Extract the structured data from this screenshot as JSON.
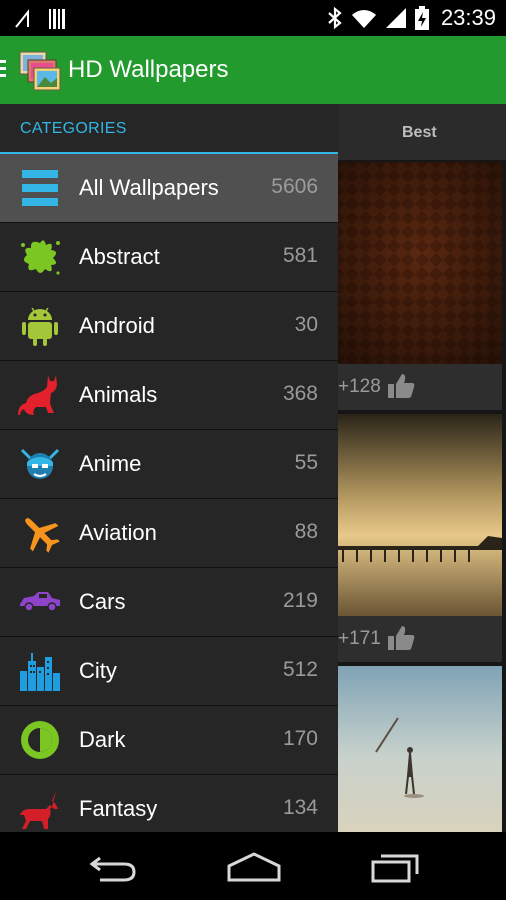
{
  "status_bar": {
    "time": "23:39",
    "icons": [
      "missed-call-icon",
      "barcode-icon",
      "bluetooth-icon",
      "wifi-icon",
      "signal-icon",
      "battery-charging-icon"
    ]
  },
  "action_bar": {
    "title": "HD Wallpapers",
    "icons": [
      "drawer-indicator-icon",
      "app-logo-icon"
    ],
    "color": "#229a2e"
  },
  "background": {
    "tab_label": "Best",
    "cards": [
      {
        "likes": "+128"
      },
      {
        "likes": "+171"
      },
      {
        "likes": ""
      }
    ]
  },
  "drawer": {
    "heading": "CATEGORIES",
    "accent": "#33b5e5",
    "categories": [
      {
        "label": "All Wallpapers",
        "count": "5606",
        "icon": "list-icon",
        "selected": true
      },
      {
        "label": "Abstract",
        "count": "581",
        "icon": "paint-splash-icon"
      },
      {
        "label": "Android",
        "count": "30",
        "icon": "android-robot-icon"
      },
      {
        "label": "Animals",
        "count": "368",
        "icon": "cat-icon"
      },
      {
        "label": "Anime",
        "count": "55",
        "icon": "anime-face-icon"
      },
      {
        "label": "Aviation",
        "count": "88",
        "icon": "airplane-icon"
      },
      {
        "label": "Cars",
        "count": "219",
        "icon": "car-icon"
      },
      {
        "label": "City",
        "count": "512",
        "icon": "city-skyline-icon"
      },
      {
        "label": "Dark",
        "count": "170",
        "icon": "half-moon-icon"
      },
      {
        "label": "Fantasy",
        "count": "134",
        "icon": "unicorn-icon"
      }
    ]
  },
  "nav_bar": {
    "icons": [
      "back-icon",
      "home-icon",
      "recents-icon"
    ]
  }
}
